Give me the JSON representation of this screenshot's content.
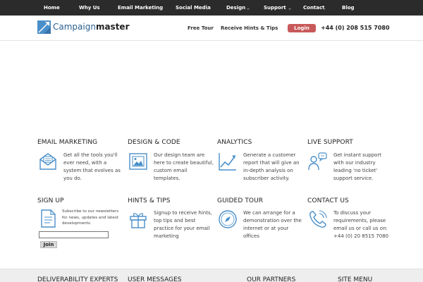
{
  "topnav": {
    "items": [
      "Home",
      "Why Us",
      "Email Marketing",
      "Social Media",
      "Design",
      "Support",
      "Contact",
      "Blog"
    ]
  },
  "header": {
    "logo_text_light": "Campaign",
    "logo_text_bold": "master",
    "links": [
      "Free Tour",
      "Receive Hints & Tips"
    ],
    "login_label": "Login",
    "phone": "+44 (0) 208 515 7080"
  },
  "features": [
    {
      "title": "EMAIL MARKETING",
      "icon": "envelope-icon",
      "text": "Get all the tools you'll ever need, with a system that evolves as you do."
    },
    {
      "title": "DESIGN & CODE",
      "icon": "image-frame-icon",
      "text": "Our design team are here to create beautiful, custom email templates."
    },
    {
      "title": "ANALYTICS",
      "icon": "line-chart-icon",
      "text": "Generate a customer report that will give an in-depth analysis on subscriber activity."
    },
    {
      "title": "LIVE SUPPORT",
      "icon": "support-agent-icon",
      "text": "Get instant support with our industry leading 'no ticket' support service."
    },
    {
      "title": "SIGN UP",
      "icon": "document-icon",
      "text": "Subscribe to our newsletters for news, updates and latest developments."
    },
    {
      "title": "HINTS & TIPS",
      "icon": "gift-icon",
      "text": "Signup to receive hints, top tips and best practice for your email marketing"
    },
    {
      "title": "GUIDED TOUR",
      "icon": "compass-icon",
      "text": "We can arrange for a demonstration over the internet or at your offices"
    },
    {
      "title": "CONTACT US",
      "icon": "phone-icon",
      "text": "To discuss your requirements, please email us or call us on: +44 (0) 20 8515 7080"
    }
  ],
  "signup": {
    "input_value": "",
    "join_label": "Join"
  },
  "footer": {
    "titles": [
      "DELIVERABILITY EXPERTS",
      "USER MESSAGES",
      "OUR PARTNERS",
      "SITE MENU"
    ]
  },
  "colors": {
    "nav_bg": "#2b2b2b",
    "login_bg": "#c8595a",
    "icon_blue": "#4a8fc9",
    "logo_blue": "#2b5f8f"
  }
}
